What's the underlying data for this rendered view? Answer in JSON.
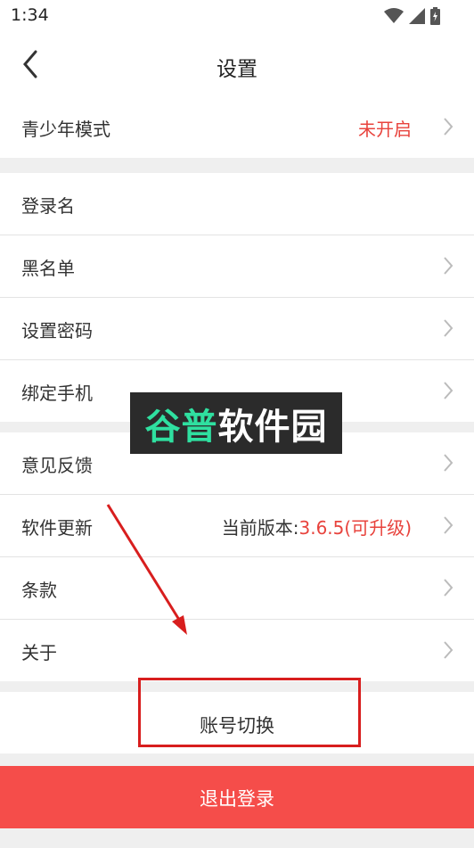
{
  "status_bar": {
    "time": "1:34",
    "icons": [
      "wifi-icon",
      "signal-icon",
      "battery-charging-icon"
    ]
  },
  "header": {
    "title": "设置",
    "back_icon": "chevron-left-icon"
  },
  "sections": [
    [
      {
        "label": "青少年模式",
        "value": "未开启",
        "value_color": "#e8433d",
        "chevron": true
      }
    ],
    [
      {
        "label": "登录名",
        "value": "",
        "chevron": false
      },
      {
        "label": "黑名单",
        "value": "",
        "chevron": true
      },
      {
        "label": "设置密码",
        "value": "",
        "chevron": true
      },
      {
        "label": "绑定手机",
        "value": "",
        "chevron": true
      }
    ],
    [
      {
        "label": "意见反馈",
        "value": "",
        "chevron": true
      },
      {
        "label": "软件更新",
        "value_prefix": "当前版本:",
        "value": "3.6.5(可升级)",
        "value_color": "#e8433d",
        "chevron": true
      },
      {
        "label": "条款",
        "value": "",
        "chevron": true
      },
      {
        "label": "关于",
        "value": "",
        "chevron": true
      }
    ]
  ],
  "account_switch": {
    "label": "账号切换"
  },
  "logout": {
    "label": "退出登录",
    "color": "#f54d4a"
  },
  "watermark": {
    "part1": "谷普",
    "part2": "软件园"
  },
  "colors": {
    "accent_red": "#e8433d",
    "highlight_box": "#d81e1e"
  }
}
